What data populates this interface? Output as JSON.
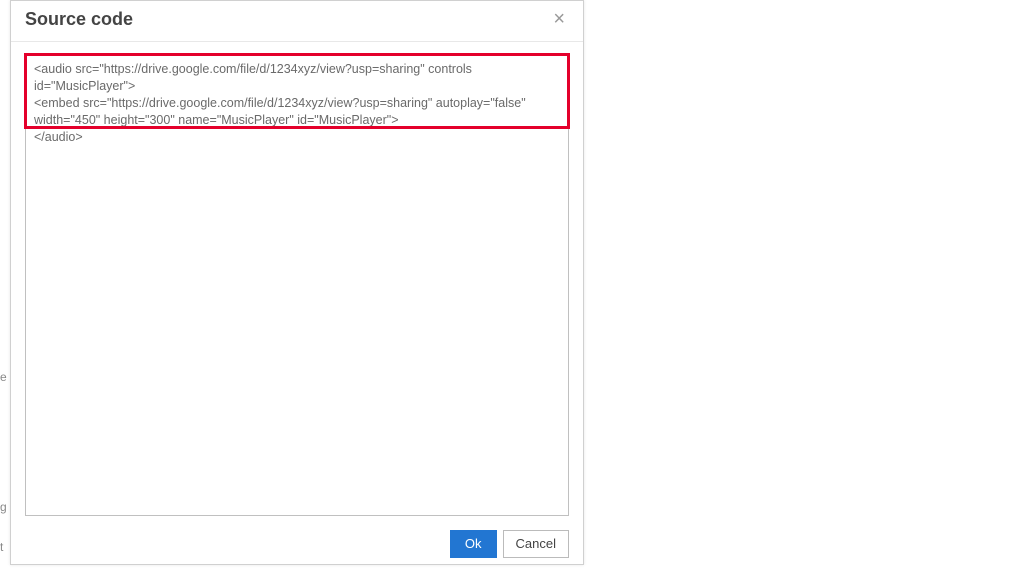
{
  "dialog": {
    "title": "Source code",
    "close_glyph": "×",
    "code_content": "<audio src=\"https://drive.google.com/file/d/1234xyz/view?usp=sharing\" controls id=\"MusicPlayer\">\n<embed src=\"https://drive.google.com/file/d/1234xyz/view?usp=sharing\" autoplay=\"false\" width=\"450\" height=\"300\" name=\"MusicPlayer\" id=\"MusicPlayer\">\n</audio>",
    "ok_label": "Ok",
    "cancel_label": "Cancel"
  },
  "background_hints": {
    "frag1": "e",
    "frag2": "g",
    "frag3": "t"
  }
}
